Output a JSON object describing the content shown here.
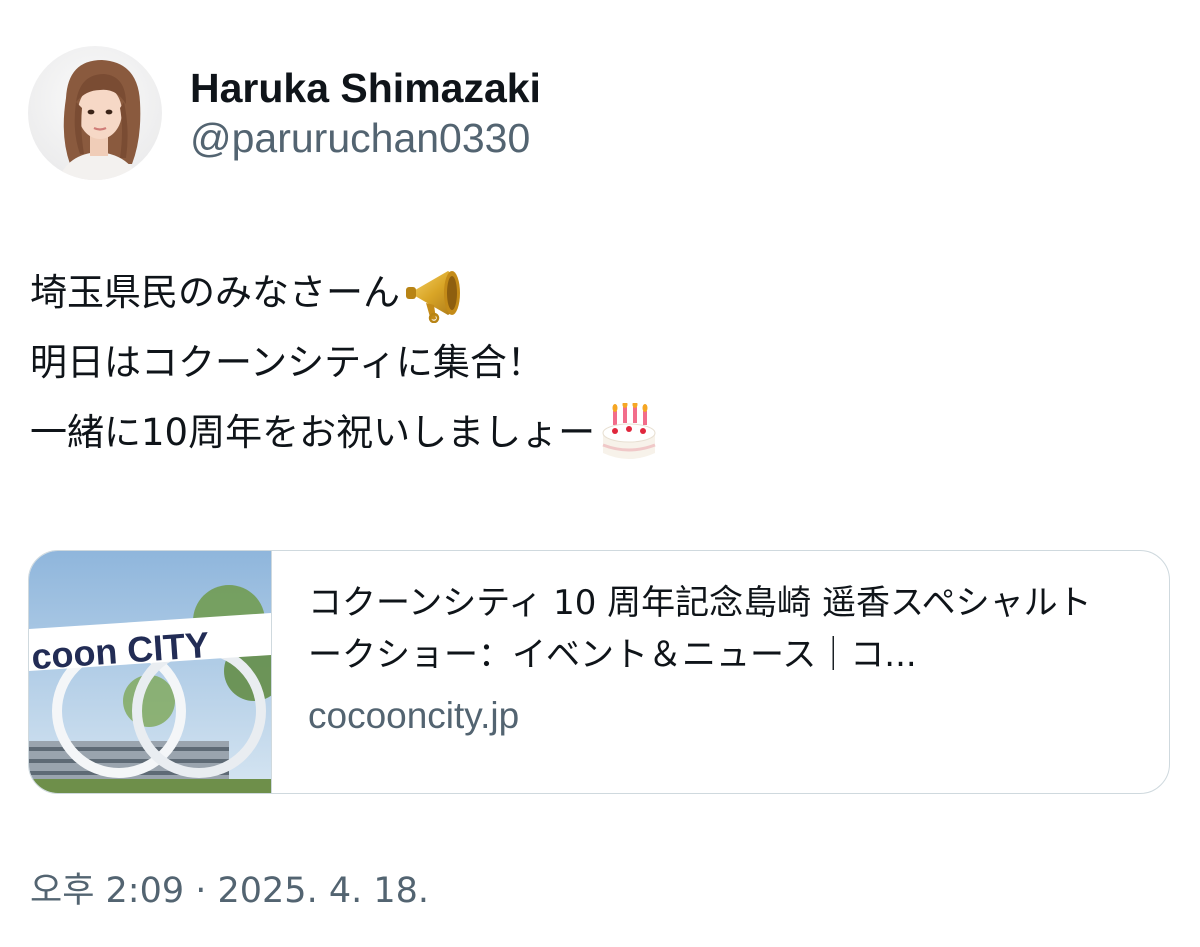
{
  "author": {
    "display_name": "Haruka Shimazaki",
    "handle": "@paruruchan0330"
  },
  "tweet": {
    "lines": [
      {
        "text": "埼玉県民のみなさーん",
        "emoji": "megaphone-icon"
      },
      {
        "text": "明日はコクーンシティに集合！",
        "emoji": ""
      },
      {
        "text": "一緒に10周年をお祝いしましょー",
        "emoji": "birthday-cake-icon"
      }
    ]
  },
  "link_card": {
    "title": "コクーンシティ 10 周年記念島崎 遥香スペシャルトークショー：イベント＆ニュース｜コ...",
    "domain": "cocooncity.jp",
    "thumbnail_sign_text": "coon CITY"
  },
  "timestamp": "오후 2:09 · 2025. 4. 18.",
  "colors": {
    "primary_text": "#0f1419",
    "secondary_text": "#536471",
    "border": "#cfd9de"
  }
}
